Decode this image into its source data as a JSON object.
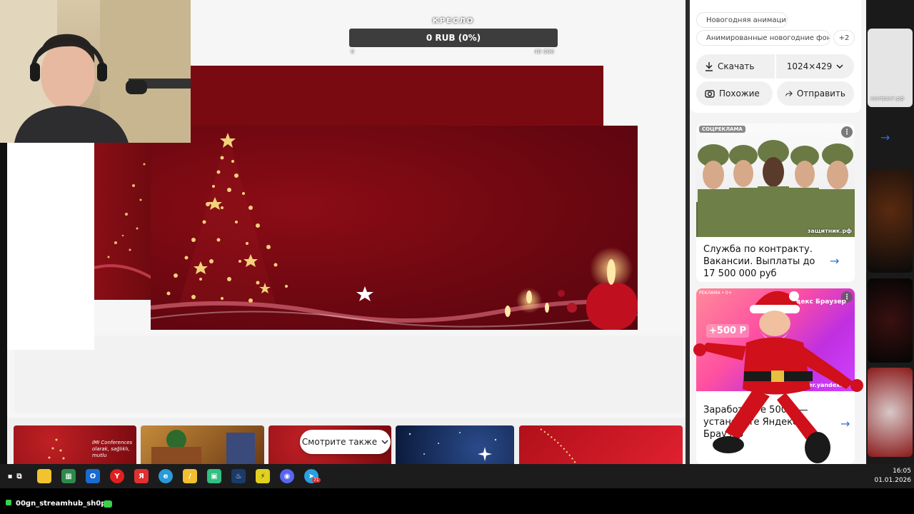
{
  "donation": {
    "label": "КРЕСЛО",
    "progress_text": "0 RUB (0%)",
    "min": "0",
    "max": "40 000"
  },
  "image_card": {
    "tags": [
      "Новогодняя анимация",
      "Анимированные новогодние фон...",
      "+2"
    ],
    "download_label": "Скачать",
    "size_label": "1024×429",
    "similar_label": "Похожие",
    "share_label": "Отправить"
  },
  "ads": [
    {
      "badge": "СОЦРЕКЛАМА",
      "site": "защитник.рф",
      "title": "Служба по контракту. Вакансии. Выплаты до 17 500 000 руб"
    },
    {
      "badge": "РЕКЛАМА • 0+",
      "brand": "Яндекс Браузер",
      "promo": "+500 Р",
      "url": "browser.yandex.ru",
      "title": "Заработайте 500 ₽ — установите Яндекс Браузер"
    }
  ],
  "gallery": {
    "see_also_label": "Смотрите также",
    "thumb_text": "IMI Conferences olarak, sağlıklı, mutlu"
  },
  "far_right": {
    "text": "контракт.рф"
  },
  "taskbar": {
    "time": "16:05",
    "date": "01.01.2026",
    "telegram_badge": "71"
  },
  "stream": {
    "name": "00gn_streamhub_sh0p"
  },
  "colors": {
    "accent": "#2a6fe0",
    "christmas_red": "#7a0a12",
    "gold": "#f2d27a"
  }
}
